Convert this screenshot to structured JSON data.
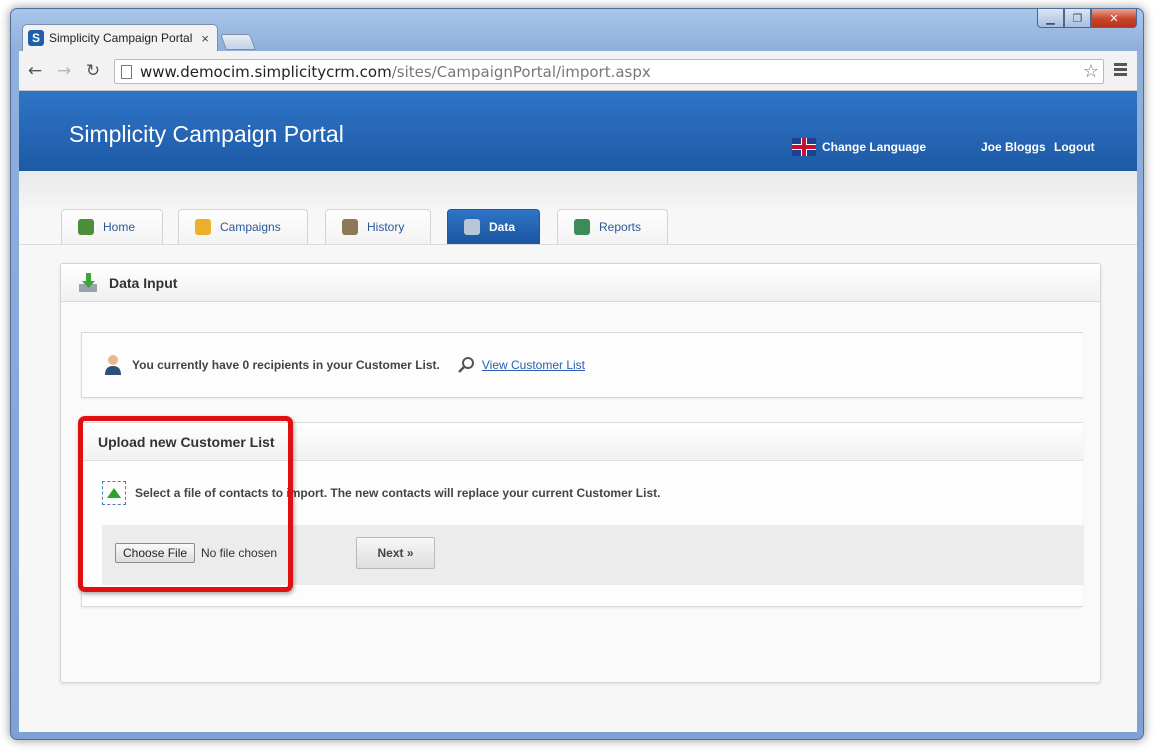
{
  "browser": {
    "tab_title": "Simplicity Campaign Portal",
    "tab_favicon": "S",
    "close_glyph": "×",
    "back_glyph": "←",
    "forward_glyph": "→",
    "reload_glyph": "↻",
    "url_host": "www.democim.simplicitycrm.com",
    "url_path": "/sites/CampaignPortal/import.aspx",
    "star_glyph": "☆",
    "window_min": "▁",
    "window_max": "❐",
    "window_close": "✕"
  },
  "header": {
    "app_title": "Simplicity Campaign Portal",
    "change_language": "Change Language",
    "user_name": "Joe Bloggs",
    "logout": "Logout"
  },
  "nav_tabs": [
    {
      "label": "Home",
      "icon": "home-icon",
      "color": "#4c8f3a"
    },
    {
      "label": "Campaigns",
      "icon": "pencil-icon",
      "color": "#e8b02b"
    },
    {
      "label": "History",
      "icon": "clock-icon",
      "color": "#8a7a5a"
    },
    {
      "label": "Data",
      "icon": "database-icon",
      "color": "#b9c7d9"
    },
    {
      "label": "Reports",
      "icon": "report-icon",
      "color": "#3f8a5b"
    }
  ],
  "panel": {
    "title": "Data Input",
    "info_text": "You currently have 0 recipients in your Customer List.",
    "view_link": "View Customer List",
    "upload_title": "Upload new Customer List",
    "upload_desc": "Select a file of contacts to import. The new contacts will replace your current Customer List.",
    "choose_file": "Choose File",
    "no_file": "No file chosen",
    "next_button": "Next »"
  },
  "colors": {
    "header_blue": "#1d5aa6",
    "highlight_red": "#e01010",
    "link_blue": "#2a5fb0"
  }
}
